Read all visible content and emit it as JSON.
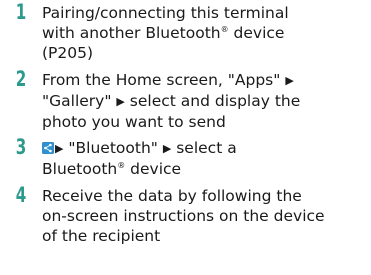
{
  "steps": [
    {
      "number": "1",
      "line1": "Pairing/connecting this terminal",
      "line2a": "with another Bluetooth",
      "reg": "®",
      "line2b": " device",
      "line3": "(P205)"
    },
    {
      "number": "2",
      "line1a": "From the Home screen, \"Apps\" ",
      "arrow1": "▶",
      "line2a": "\"Gallery\" ",
      "arrow2": "▶",
      "line2b": " select and display the",
      "line3": "photo you want to send"
    },
    {
      "number": "3",
      "icon": "share-icon",
      "arrow1": "▶",
      "line1a": " \"Bluetooth\" ",
      "arrow2": "▶",
      "line1b": " select a",
      "line2a": "Bluetooth",
      "reg": "®",
      "line2b": " device"
    },
    {
      "number": "4",
      "line1": "Receive the data by following the",
      "line2": "on-screen instructions on the device",
      "line3": "of the recipient"
    }
  ],
  "colors": {
    "step_number": "#2c9a8c",
    "text": "#1a1a1a",
    "icon_bg": "#2f8fcf"
  }
}
